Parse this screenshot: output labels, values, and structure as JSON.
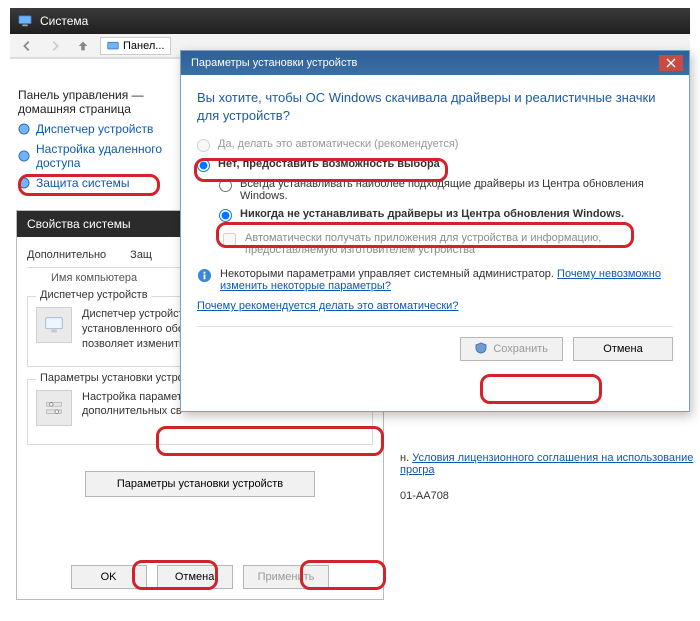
{
  "outer": {
    "title": "Система",
    "pathLabel": "Панел..."
  },
  "sidebar": {
    "heading": "Панель управления — домашняя страница",
    "items": [
      {
        "label": "Диспетчер устройств"
      },
      {
        "label": "Настройка удаленного доступа"
      },
      {
        "label": "Защита системы"
      }
    ]
  },
  "sysprops": {
    "title": "Свойства системы",
    "tabs": {
      "left": "Дополнительно",
      "mid": "Защ",
      "right": "Имя компьютера"
    },
    "group1": {
      "legend": "Диспетчер устройств",
      "text": "Диспетчер устройст\nустановленного обо\nпозволяет изменить"
    },
    "group2": {
      "legend": "Параметры установки устрой",
      "text": "Настройка парамет\nдополнительных св"
    },
    "button": "Параметры установки устройств",
    "ok": "OK",
    "cancel": "Отмена",
    "apply": "Применить"
  },
  "rightText": {
    "licensePrefix": "н. ",
    "licenseLink": "Условия лицензионного соглашения на использование програ",
    "key": "01-AA708"
  },
  "dialog": {
    "title": "Параметры установки устройств",
    "heading": "Вы хотите, чтобы ОС Windows скачивала драйверы и реалистичные значки для устройств?",
    "optYes": "Да, делать это автоматически (рекомендуется)",
    "optNo": "Нет, предоставить возможность выбора",
    "subAlways": "Всегда устанавливать наиболее подходящие драйверы из Центра обновления Windows.",
    "subNever": "Никогда не устанавливать драйверы из Центра обновления Windows.",
    "chkApp": "Автоматически получать приложения для устройства и информацию, предоставляемую изготовителем устройства",
    "infoPrefix": "Некоторыми параметрами управляет системный администратор. ",
    "infoLink": "Почему невозможно изменить некоторые параметры?",
    "whyLink": "Почему рекомендуется делать это автоматически?",
    "save": "Сохранить",
    "cancel": "Отмена"
  }
}
